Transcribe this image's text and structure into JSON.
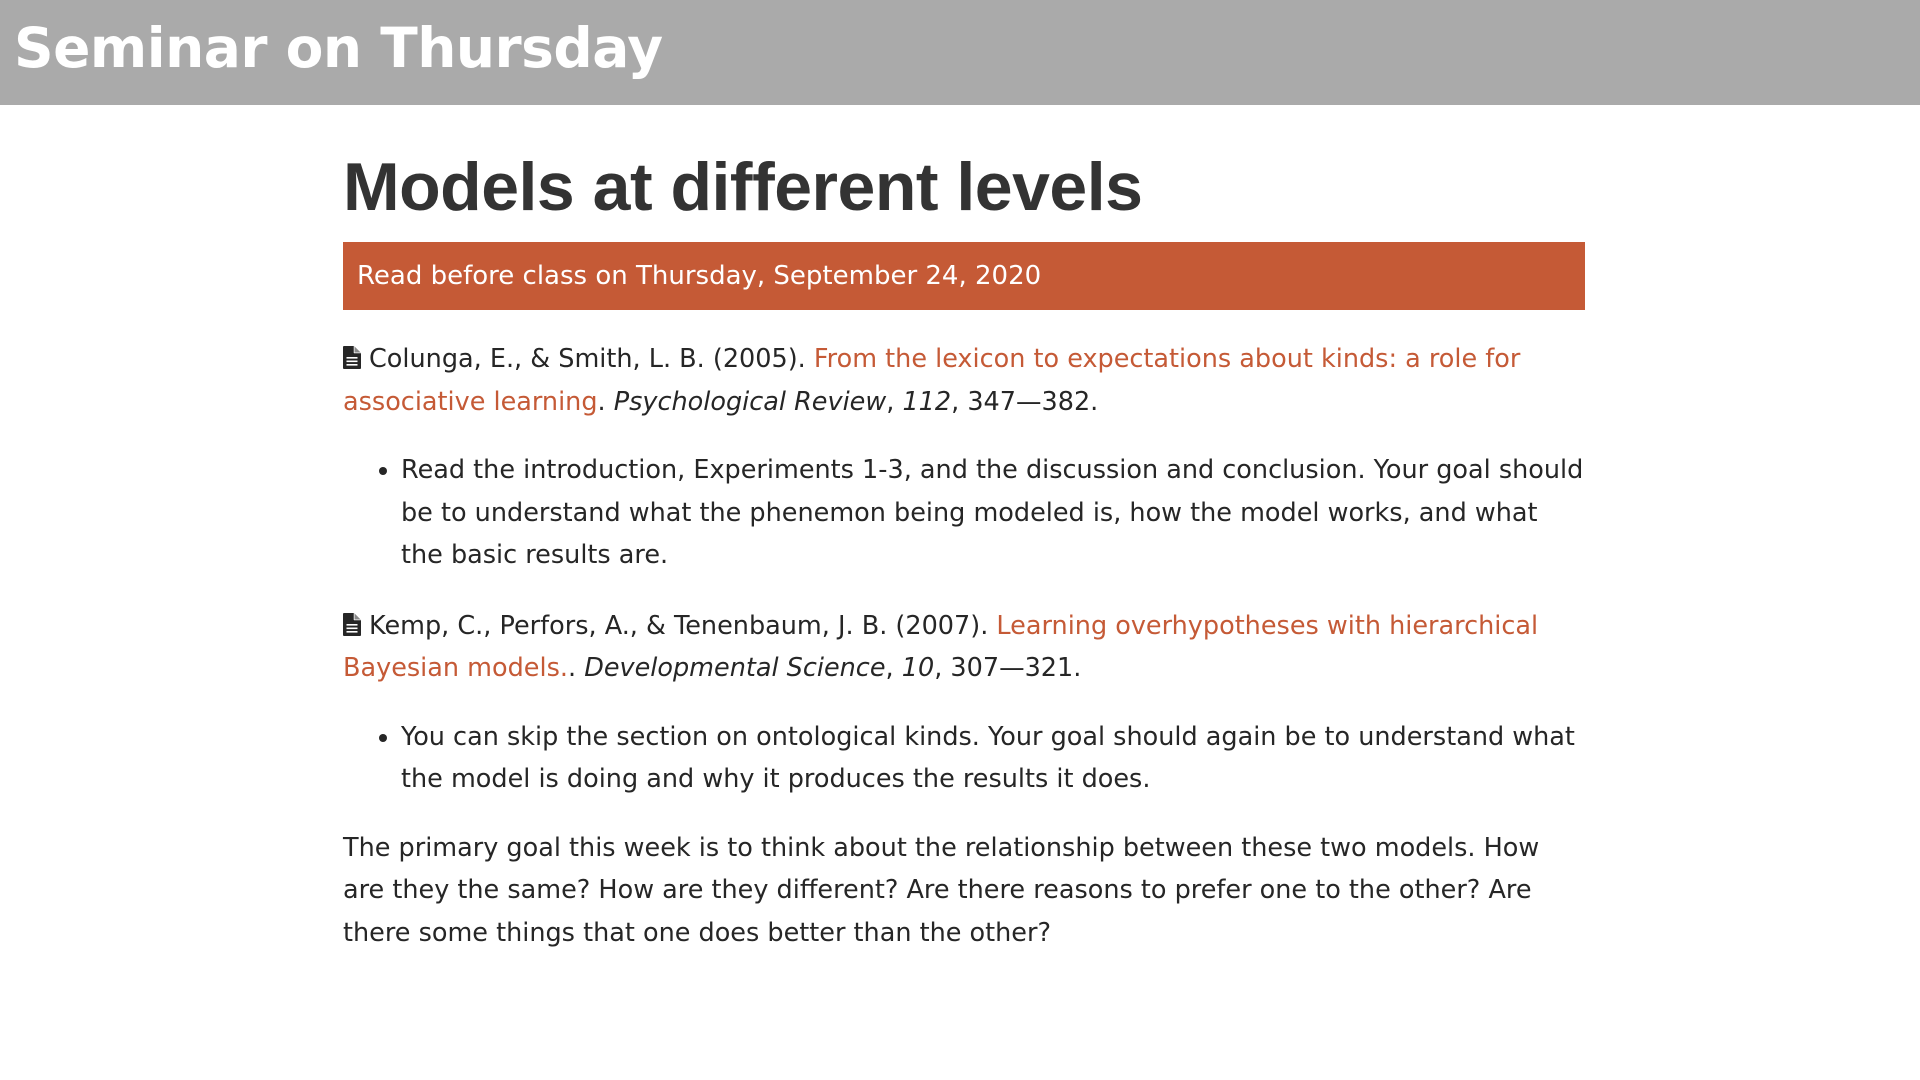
{
  "header": {
    "title": "Seminar on Thursday"
  },
  "main": {
    "title": "Models at different levels",
    "banner": "Read before class on Thursday, September 24, 2020",
    "readings": [
      {
        "icon": "document-icon",
        "authors": "Colunga, E., & Smith, L. B. (2005).",
        "link_text": "From the lexicon to expectations about kinds: a role for associative learning",
        "after_link": ".",
        "journal": "Psychological Review",
        "volume": "112",
        "pages": ", 347—382.",
        "note": "Read the introduction, Experiments 1-3, and the discussion and conclusion. Your goal should be to understand what the phenemon being modeled is, how the model works, and what the basic results are."
      },
      {
        "icon": "document-icon",
        "authors": "Kemp, C., Perfors, A., & Tenenbaum, J. B. (2007).",
        "link_text": "Learning overhypotheses with hierarchical Bayesian models.",
        "after_link": ".",
        "journal": "Developmental Science",
        "volume": "10",
        "pages": ", 307—321.",
        "note": "You can skip the section on ontological kinds. Your goal should again be to understand what the model is doing and why it produces the results it does."
      }
    ],
    "summary": "The primary goal this week is to think about the relationship between these two models. How are they the same? How are they different? Are there reasons to prefer one to the other? Are there some things that one does better than the other?"
  },
  "colors": {
    "header_bg": "#aaaaaa",
    "accent": "#c55a36",
    "text": "#262626"
  }
}
